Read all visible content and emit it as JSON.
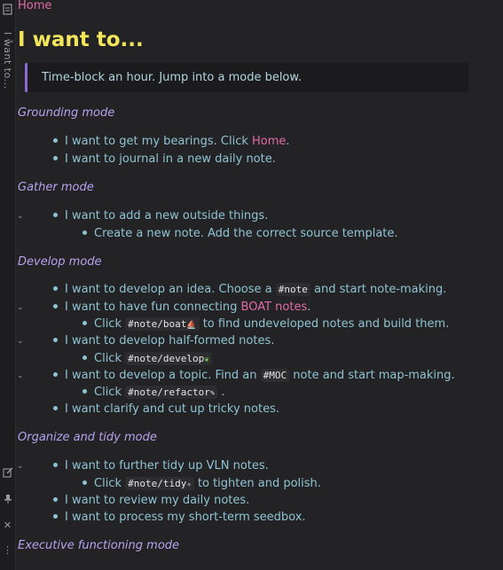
{
  "rail": {
    "vertical_title": "I want to...",
    "icons": [
      "file-icon",
      "edit-icon",
      "pin-icon",
      "close-icon",
      "more-icon"
    ]
  },
  "breadcrumb": {
    "home": "Home"
  },
  "title": "I want to...",
  "callout": "Time-block an hour. Jump into a mode below.",
  "sections": {
    "grounding": "Grounding mode",
    "gather": "Gather mode",
    "develop": "Develop mode",
    "organize": "Organize and tidy mode",
    "executive": "Executive functioning mode"
  },
  "items": {
    "g1_pre": "I want to get my bearings. Click ",
    "g1_link": "Home",
    "g1_post": ".",
    "g2": "I want to journal in a new daily note.",
    "ga1": "I want to add a new outside things.",
    "ga1a": "Create a new note. Add the correct source template.",
    "d1_pre": "I want to develop an idea. Choose a ",
    "d1_tag": "#note",
    "d1_post": " and start note-making.",
    "d2_pre": "I want to have fun connecting ",
    "d2_link": "BOAT notes",
    "d2_post": ".",
    "d2a_pre": "Click ",
    "d2a_tag": "#note/boat",
    "d2a_post": " to find undeveloped notes and build them.",
    "d3": "I want to develop half-formed notes.",
    "d3a_pre": "Click ",
    "d3a_tag": "#note/develop",
    "d4_pre": "I want to develop a topic. Find an ",
    "d4_tag": "#MOC",
    "d4_post": " note and start map-making.",
    "d4a_pre": "Click ",
    "d4a_tag": "#note/refactor",
    "d4a_post": " .",
    "d5": "I want clarify and cut up tricky notes.",
    "o1": "I want to further tidy up VLN notes.",
    "o1a_pre": "Click ",
    "o1a_tag": "#note/tidy",
    "o1a_post": " to tighten and polish.",
    "o2": "I want to review my daily notes.",
    "o3": "I want to process my short-term seedbox."
  },
  "colors": {
    "background": "#232325",
    "heading": "#f2e55c",
    "link": "#e26aa8",
    "section": "#b7a3f0",
    "text": "#8fc3d3",
    "callout_border": "#8c6bd6"
  }
}
